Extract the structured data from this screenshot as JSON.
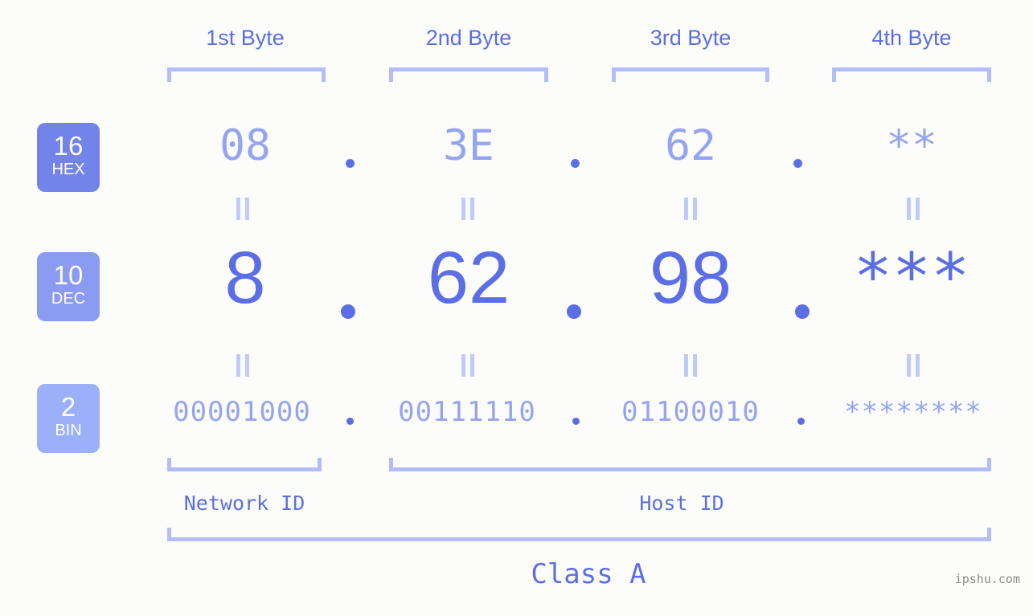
{
  "background_color": "#fcfdfa",
  "accent_colors": {
    "strong_blue": "#5b6ee6",
    "mid_blue": "#94a4f2",
    "light_blue": "#b3bdfb",
    "badge_hex": "#7283ea",
    "badge_dec": "#8b9bf2",
    "badge_bin": "#9bb0f8"
  },
  "column_headers": [
    {
      "label": "1st Byte"
    },
    {
      "label": "2nd Byte"
    },
    {
      "label": "3rd Byte"
    },
    {
      "label": "4th Byte"
    }
  ],
  "bases": [
    {
      "number": "16",
      "name": "HEX"
    },
    {
      "number": "10",
      "name": "DEC"
    },
    {
      "number": "2",
      "name": "BIN"
    }
  ],
  "rows": {
    "hex": {
      "base_number": "16",
      "base_name": "HEX",
      "values": [
        "08",
        "3E",
        "62",
        "**"
      ],
      "separator": "."
    },
    "dec": {
      "base_number": "10",
      "base_name": "DEC",
      "values": [
        "8",
        "62",
        "98",
        "***"
      ],
      "separator": "."
    },
    "bin": {
      "base_number": "2",
      "base_name": "BIN",
      "values": [
        "00001000",
        "00111110",
        "01100010",
        "********"
      ],
      "separator": "."
    }
  },
  "equals_marks": {
    "glyph": "=",
    "count_per_row": 4
  },
  "regions": {
    "network_id": "Network ID",
    "host_id": "Host ID",
    "class": "Class A"
  },
  "watermark": "ipshu.com"
}
